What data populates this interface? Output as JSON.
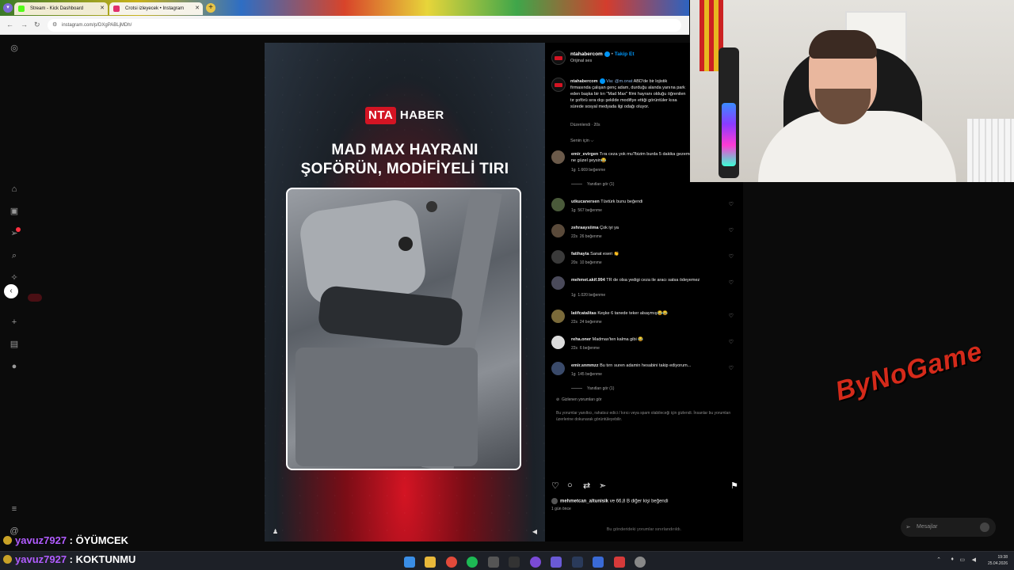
{
  "browser": {
    "tabs": [
      {
        "label": "Stream - Kick Dashboard",
        "favicon_color": "#53fc18"
      },
      {
        "label": "Crotsi izleyecek • Instagram",
        "favicon_color": "#e1306c"
      }
    ],
    "url": "instagram.com/p/DXgPABLjMDh/"
  },
  "video": {
    "logo_nta": "NTA",
    "logo_haber": "HABER",
    "title_line1": "MAD MAX HAYRANI",
    "title_line2": "ŞOFÖRÜN, MODİFİYELİ TIRI"
  },
  "post": {
    "author": "ntahabercom",
    "follow": "Takip Et",
    "audio": "Orijinal ses",
    "caption_author": "ntahabercom",
    "caption_via": "Via: @m.onat",
    "caption_text": "ABD'de bir lojistik firmasında çalışan genç adam, durduğu alanda yanına park eden başka bir tırı \"Mad Max\" filmi hayranı olduğu öğrenilen tır şoförü sıra dışı şekilde modifiye ettiği görüntüler kısa sürede sosyal medyada ilgi odağı oluyor.",
    "caption_meta": "Düzenlendi · 20s",
    "sort_label": "Senin için ⌵",
    "comments": [
      {
        "user": "emir_evirgen",
        "text": "Tıra ceza yok mu?bizim burda 5 dakika gezemez!!medeniyet ne güzel şeysin😂",
        "time": "1g",
        "likes": "1.669 beğenme",
        "replies": "Yanıtları gör (1)"
      },
      {
        "user": "utkucanersen",
        "text": "Tüvtürk bunu beğendi",
        "time": "1g",
        "likes": "567 beğenme"
      },
      {
        "user": "zehraaysiima",
        "text": "Çok iyi ya",
        "time": "22s",
        "likes": "26 beğenme"
      },
      {
        "user": "fatihayta",
        "text": "Sanat eseri 👏",
        "time": "20s",
        "likes": "10 beğenme"
      },
      {
        "user": "mehmet.akif.994",
        "text": "TR de olsa yedigi ceza ile aracı satsa ödeyemez",
        "time": "1g",
        "likes": "1.020 beğenme"
      },
      {
        "user": "latifcatalitas",
        "text": "Keşke 6 tanede teker alsaymış😂😂",
        "time": "22s",
        "likes": "24 beğenme"
      },
      {
        "user": "reha.oner",
        "text": "Madmax'ten kalma gibi 😂",
        "time": "22s",
        "likes": "6 beğenme"
      },
      {
        "user": "emir.snmmzz",
        "text": "Bu tırrı suren adamin hesabini takip ediyorum...",
        "time": "1g",
        "likes": "145 beğenme",
        "replies": "Yanıtları gör (1)"
      }
    ],
    "hidden_title": "Gizlenen yorumları gör",
    "hidden_body": "Bu yorumlar yanıltıcı, rahatsız edici / kırıcı veya spam olabileceği için gizlendi. İnsanlar bu yorumları üzerlerine dokunarak görüntüleyebilir.",
    "likes_user": "mehmetcan_altunisik",
    "likes_rest": "ve 66,8 B diğer kişi beğendi",
    "ago": "1 gün önce",
    "limited": "Bu gönderideki yorumlar sınırlandırıldı."
  },
  "messages_label": "Mesajlar",
  "watermark": "ByNoGame",
  "chat": [
    {
      "user": "yavuz7927",
      "message": "ÖYÜMCEK"
    },
    {
      "user": "yavuz7927",
      "message": "KOKTUNMU"
    }
  ],
  "taskbar": {
    "time": "19:38",
    "date": "25.04.2026"
  },
  "colors": {
    "instagram_blue": "#0095f6",
    "nta_red": "#d41423",
    "chat_user": "#b15cff",
    "watermark": "#d52a1a"
  }
}
